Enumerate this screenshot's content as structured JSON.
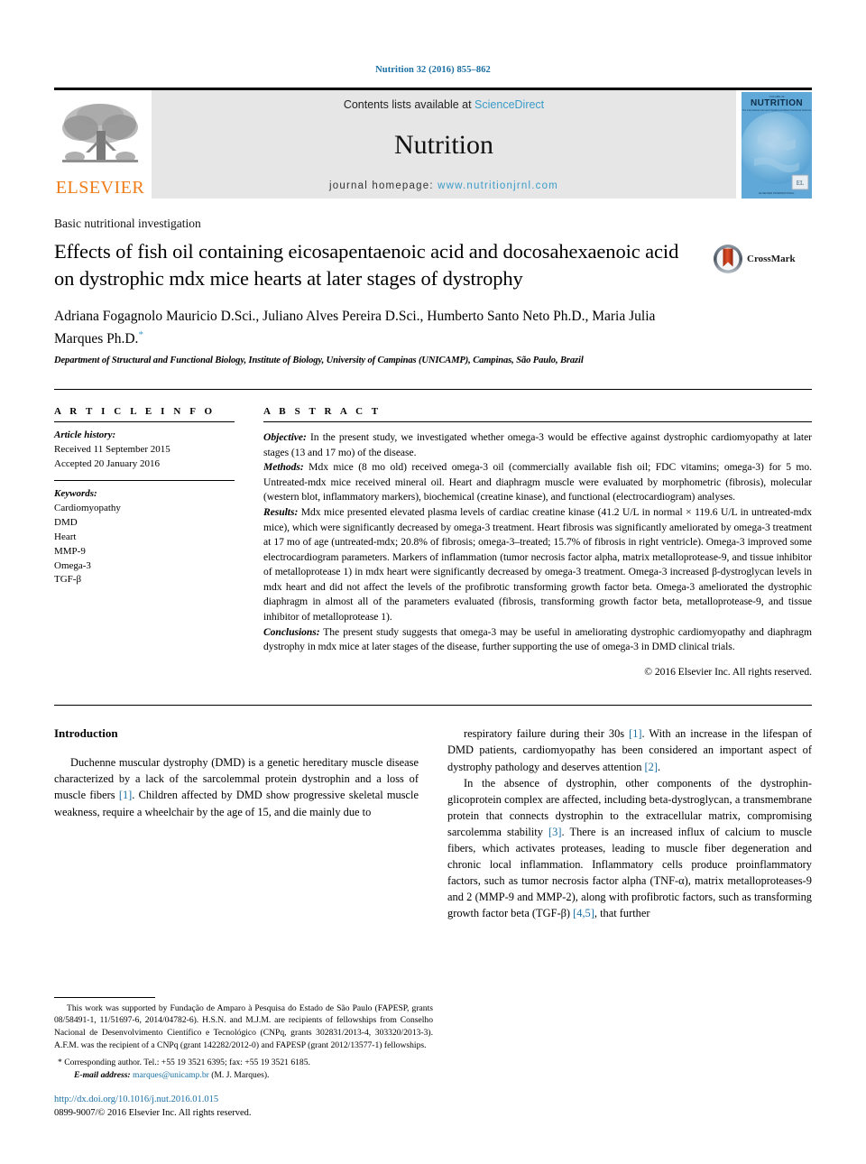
{
  "running_head": "Nutrition 32 (2016) 855–862",
  "masthead": {
    "publisher_name": "ELSEVIER",
    "contents_prefix": "Contents lists available at ",
    "contents_link": "ScienceDirect",
    "journal_name": "Nutrition",
    "homepage_prefix": "journal homepage: ",
    "homepage_url": "www.nutritionjrnl.com",
    "cover_title": "NUTRITION",
    "cover_subtitle": "The International Journal of Applied and Basic Nutritional Sciences"
  },
  "article": {
    "kicker": "Basic nutritional investigation",
    "title": "Effects of fish oil containing eicosapentaenoic acid and docosahexaenoic acid on dystrophic mdx mice hearts at later stages of dystrophy",
    "authors": "Adriana Fogagnolo Mauricio D.Sci., Juliano Alves Pereira D.Sci., Humberto Santo Neto Ph.D., Maria Julia Marques Ph.D.",
    "corresponding_marker": "*",
    "affiliation": "Department of Structural and Functional Biology, Institute of Biology, University of Campinas (UNICAMP), Campinas, São Paulo, Brazil",
    "crossmark_label": "CrossMark"
  },
  "article_info": {
    "heading": "A R T I C L E  I N F O",
    "history_label": "Article history:",
    "history": [
      "Received 11 September 2015",
      "Accepted 20 January 2016"
    ],
    "keywords_label": "Keywords:",
    "keywords": [
      "Cardiomyopathy",
      "DMD",
      "Heart",
      "MMP-9",
      "Omega-3",
      "TGF-β"
    ]
  },
  "abstract": {
    "heading": "A B S T R A C T",
    "sections": [
      {
        "label": "Objective:",
        "text": " In the present study, we investigated whether omega-3 would be effective against dystrophic cardiomyopathy at later stages (13 and 17 mo) of the disease."
      },
      {
        "label": "Methods:",
        "text": " Mdx mice (8 mo old) received omega-3 oil (commercially available fish oil; FDC vitamins; omega-3) for 5 mo. Untreated-mdx mice received mineral oil. Heart and diaphragm muscle were evaluated by morphometric (fibrosis), molecular (western blot, inflammatory markers), biochemical (creatine kinase), and functional (electrocardiogram) analyses."
      },
      {
        "label": "Results:",
        "text": " Mdx mice presented elevated plasma levels of cardiac creatine kinase (41.2 U/L in normal × 119.6 U/L in untreated-mdx mice), which were significantly decreased by omega-3 treatment. Heart fibrosis was significantly ameliorated by omega-3 treatment at 17 mo of age (untreated-mdx; 20.8% of fibrosis; omega-3–treated; 15.7% of fibrosis in right ventricle). Omega-3 improved some electrocardiogram parameters. Markers of inflammation (tumor necrosis factor alpha, matrix metalloprotease-9, and tissue inhibitor of metalloprotease 1) in mdx heart were significantly decreased by omega-3 treatment. Omega-3 increased β-dystroglycan levels in mdx heart and did not affect the levels of the profibrotic transforming growth factor beta. Omega-3 ameliorated the dystrophic diaphragm in almost all of the parameters evaluated (fibrosis, transforming growth factor beta, metalloprotease-9, and tissue inhibitor of metalloprotease 1)."
      },
      {
        "label": "Conclusions:",
        "text": " The present study suggests that omega-3 may be useful in ameliorating dystrophic cardiomyopathy and diaphragm dystrophy in mdx mice at later stages of the disease, further supporting the use of omega-3 in DMD clinical trials."
      }
    ],
    "copyright": "© 2016 Elsevier Inc. All rights reserved."
  },
  "introduction": {
    "heading": "Introduction",
    "left_paragraph_1_a": "Duchenne muscular dystrophy (DMD) is a genetic hereditary muscle disease characterized by a lack of the sarcolemmal protein dystrophin and a loss of muscle fibers ",
    "left_ref_1": "[1]",
    "left_paragraph_1_b": ". Children affected by DMD show progressive skeletal muscle weakness, require a wheelchair by the age of 15, and die mainly due to",
    "right_paragraph_1_a": "respiratory failure during their 30s ",
    "right_ref_1": "[1]",
    "right_paragraph_1_b": ". With an increase in the lifespan of DMD patients, cardiomyopathy has been considered an important aspect of dystrophy pathology and deserves attention ",
    "right_ref_2": "[2]",
    "right_paragraph_1_c": ".",
    "right_paragraph_2_a": "In the absence of dystrophin, other components of the dystrophin-glicoprotein complex are affected, including beta-dystroglycan, a transmembrane protein that connects dystrophin to the extracellular matrix, compromising sarcolemma stability ",
    "right_ref_3": "[3]",
    "right_paragraph_2_b": ". There is an increased influx of calcium to muscle fibers, which activates proteases, leading to muscle fiber degeneration and chronic local inflammation. Inflammatory cells produce proinflammatory factors, such as tumor necrosis factor alpha (TNF-α), matrix metalloproteases-9 and 2 (MMP-9 and MMP-2), along with profibrotic factors, such as transforming growth factor beta (TGF-β) ",
    "right_ref_4": "[4,5]",
    "right_paragraph_2_c": ", that further"
  },
  "footnotes": {
    "funding": "This work was supported by Fundação de Amparo à Pesquisa do Estado de São Paulo (FAPESP, grants 08/58491-1, 11/51697-6, 2014/04782-6). H.S.N. and M.J.M. are recipients of fellowships from Conselho Nacional de Desenvolvimento Científico e Tecnológico (CNPq, grants 302831/2013-4, 303320/2013-3). A.F.M. was the recipient of a CNPq (grant 142282/2012-0) and FAPESP (grant 2012/13577-1) fellowships.",
    "corresponding": "* Corresponding author. Tel.: +55 19 3521 6395; fax: +55 19 3521 6185.",
    "email_label": "E-mail address:",
    "email": "marques@unicamp.br",
    "email_suffix": " (M. J. Marques).",
    "doi": "http://dx.doi.org/10.1016/j.nut.2016.01.015",
    "issn_line": "0899-9007/© 2016 Elsevier Inc. All rights reserved."
  },
  "colors": {
    "link_blue": "#1a6fa3",
    "sciencedirect_blue": "#3a9bc8",
    "elsevier_orange": "#ef7d1a",
    "masthead_grey": "#e6e6e6"
  }
}
